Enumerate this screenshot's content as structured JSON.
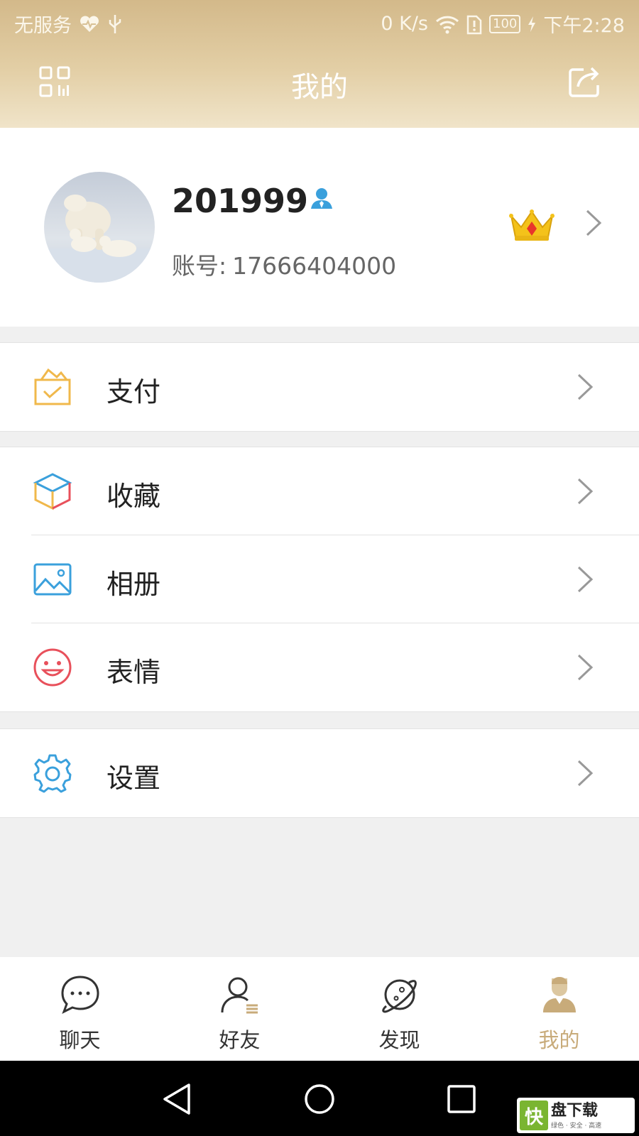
{
  "status_bar": {
    "carrier": "无服务",
    "speed": "0 K/s",
    "battery": "100",
    "time": "下午2:28"
  },
  "header": {
    "title": "我的"
  },
  "profile": {
    "nickname": "201999",
    "account_label": "账号:",
    "account_value": "17666404000"
  },
  "menu": {
    "pay": "支付",
    "favorites": "收藏",
    "album": "相册",
    "emoji": "表情",
    "settings": "设置"
  },
  "tabbar": [
    {
      "label": "聊天",
      "icon": "chat-bubble-icon"
    },
    {
      "label": "好友",
      "icon": "friends-icon"
    },
    {
      "label": "发现",
      "icon": "planet-icon"
    },
    {
      "label": "我的",
      "icon": "me-icon",
      "active": true
    }
  ],
  "watermark": {
    "logo": "快",
    "title": "盘下载",
    "subtitle": "绿色 · 安全 · 高速"
  },
  "colors": {
    "header_gradient_top": "#d3b98a",
    "header_gradient_bottom": "#f0e4c9",
    "accent_gold": "#c8ab7a",
    "pay_icon": "#f0b84b",
    "album_icon": "#3aa0dc",
    "emoji_icon": "#e8505b",
    "settings_icon": "#3aa0dc"
  }
}
